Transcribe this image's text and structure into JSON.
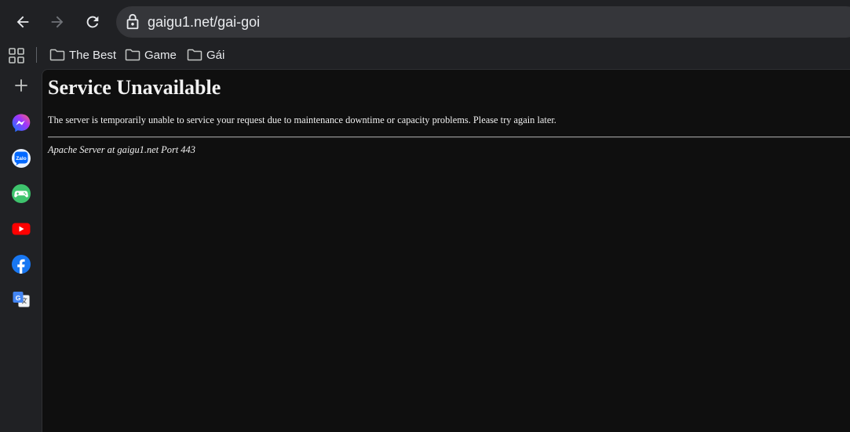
{
  "toolbar": {
    "back_icon": "arrow-left-icon",
    "forward_icon": "arrow-right-icon",
    "reload_icon": "reload-icon",
    "security_icon": "lock-icon",
    "url": "gaigu1.net/gai-goi"
  },
  "bookmarks": {
    "apps_icon": "apps-grid-icon",
    "items": [
      {
        "label": "The Best",
        "icon": "folder-icon"
      },
      {
        "label": "Game",
        "icon": "folder-icon"
      },
      {
        "label": "Gái",
        "icon": "folder-icon"
      }
    ]
  },
  "sidebar": {
    "items": [
      {
        "name": "add",
        "icon": "plus-icon"
      },
      {
        "name": "messenger",
        "icon": "messenger-icon",
        "color": "#a334fa"
      },
      {
        "name": "zalo",
        "icon": "zalo-icon",
        "color": "#0068ff"
      },
      {
        "name": "game",
        "icon": "gamepad-icon",
        "color": "#3ec46d"
      },
      {
        "name": "youtube",
        "icon": "youtube-icon",
        "color": "#ff0000"
      },
      {
        "name": "facebook",
        "icon": "facebook-icon",
        "color": "#1877f2"
      },
      {
        "name": "translate",
        "icon": "translate-icon",
        "color": "#4285f4"
      }
    ]
  },
  "page": {
    "title": "Service Unavailable",
    "message": "The server is temporarily unable to service your request due to maintenance downtime or capacity problems. Please try again later.",
    "footer": "Apache Server at gaigu1.net Port 443"
  },
  "colors": {
    "chrome_bg": "#202124",
    "omnibox_bg": "#35363a",
    "page_bg": "#0f0f0f",
    "text": "#e8eaed"
  }
}
